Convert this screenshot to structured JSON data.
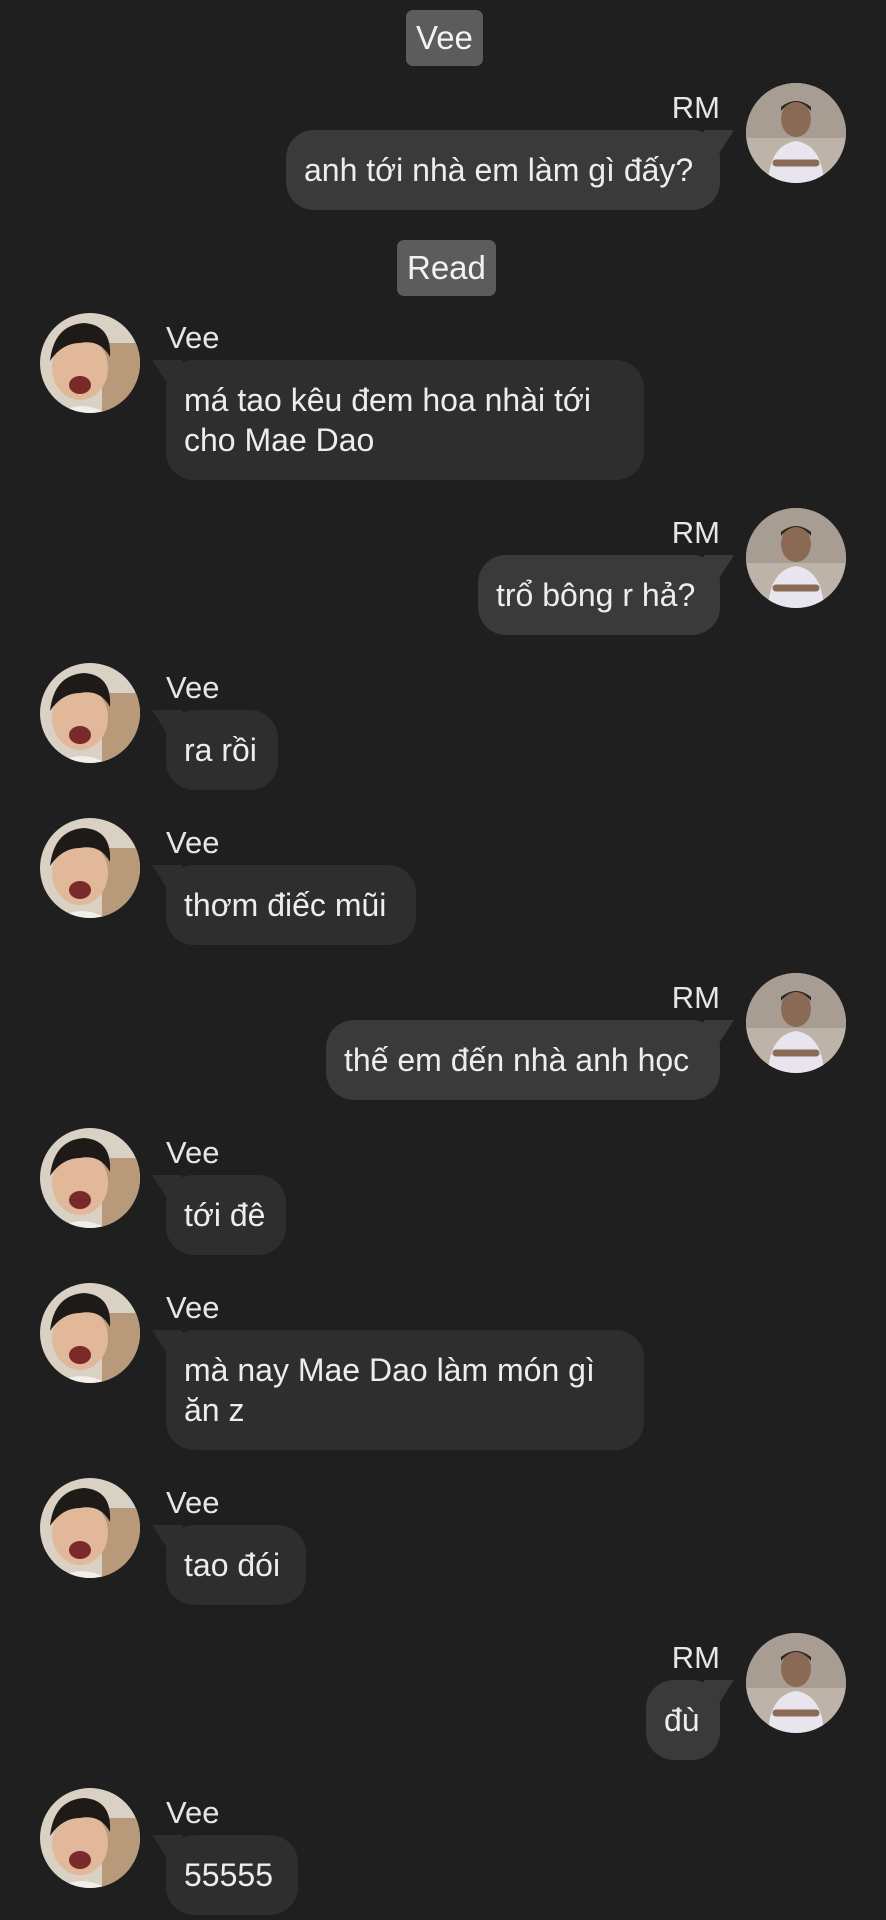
{
  "colors": {
    "background": "#1f1f1f",
    "bubble_outgoing": "#3a3a3a",
    "bubble_incoming": "#2e2e2e",
    "pill": "#5c5c5c"
  },
  "header": {
    "contact_name": "Vee"
  },
  "read_receipt": "Read",
  "participants": {
    "me": "RM",
    "them": "Vee"
  },
  "messages": [
    {
      "sender": "RM",
      "text": "anh tới nhà em làm gì đấy?"
    },
    {
      "sender": "Vee",
      "text": "má tao kêu đem hoa nhài tới\ncho Mae Dao"
    },
    {
      "sender": "RM",
      "text": "trổ bông r hả?"
    },
    {
      "sender": "Vee",
      "text": "ra rồi"
    },
    {
      "sender": "Vee",
      "text": "thơm điếc mũi"
    },
    {
      "sender": "RM",
      "text": "thế em đến nhà anh học"
    },
    {
      "sender": "Vee",
      "text": "tới đê"
    },
    {
      "sender": "Vee",
      "text": "mà nay Mae Dao làm món gì\năn z"
    },
    {
      "sender": "Vee",
      "text": "tao đói"
    },
    {
      "sender": "RM",
      "text": "đù"
    },
    {
      "sender": "Vee",
      "text": "55555"
    }
  ],
  "avatars": {
    "me_icon": "person-portrait-icon",
    "them_icon": "person-selfie-icon"
  }
}
